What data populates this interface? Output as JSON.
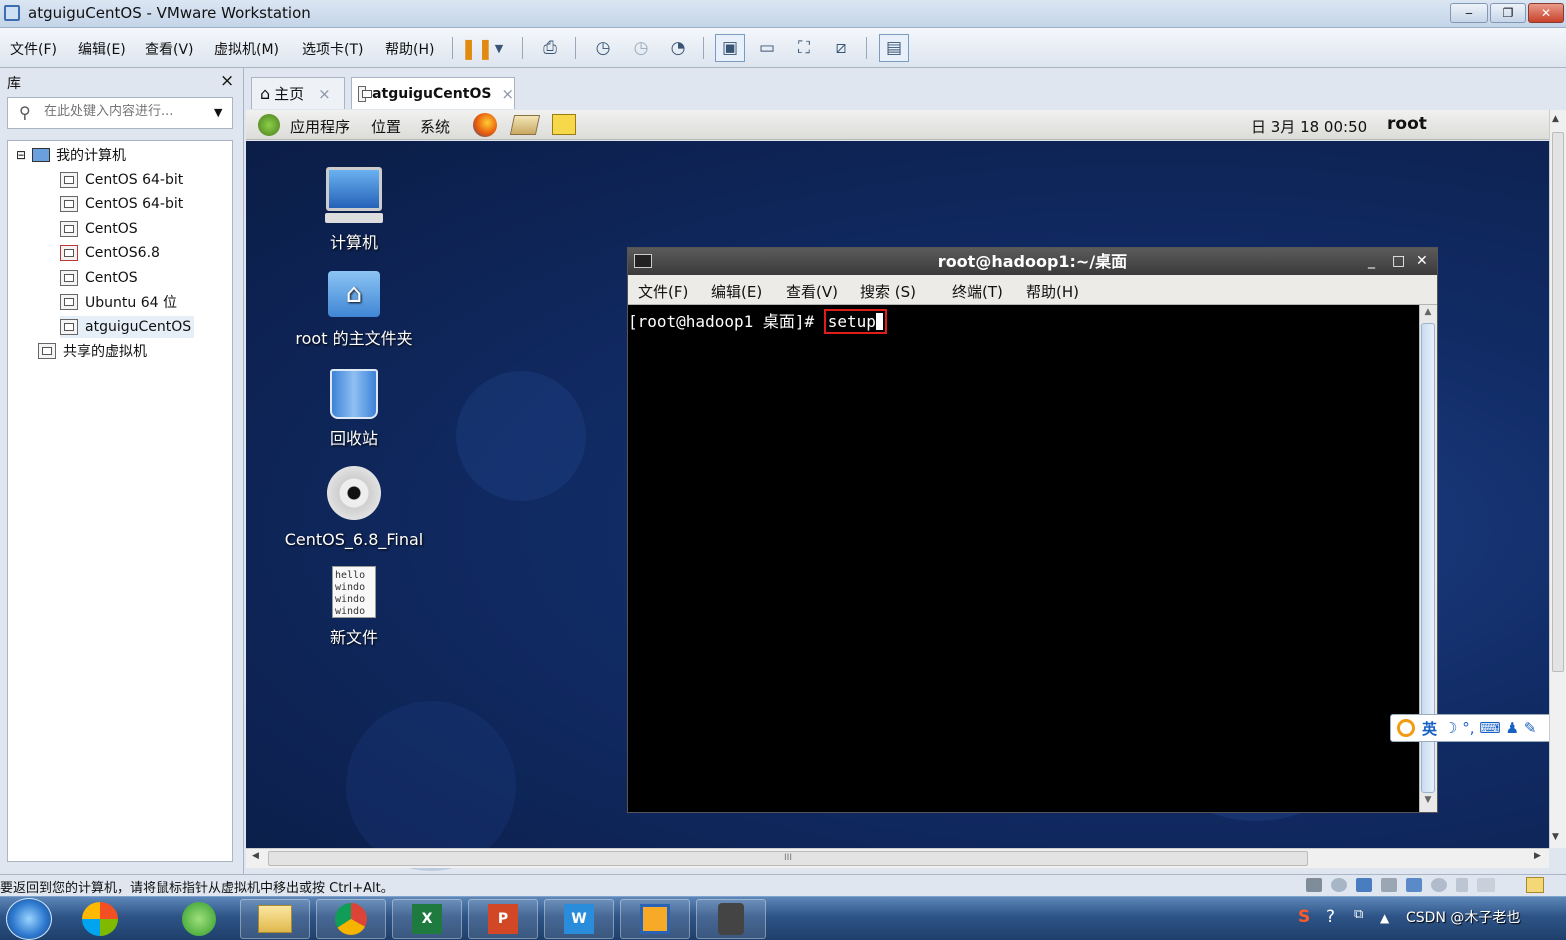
{
  "window": {
    "title": "atguiguCentOS - VMware Workstation",
    "controls": [
      "‒",
      "❐",
      "✕"
    ]
  },
  "menubar": [
    "文件(F)",
    "编辑(E)",
    "查看(V)",
    "虚拟机(M)",
    "选项卡(T)",
    "帮助(H)"
  ],
  "library": {
    "title": "库",
    "close": "×",
    "search_placeholder": "在此处键入内容进行...",
    "tree": {
      "root": "我的计算机",
      "toggle": "⊟",
      "vms": [
        "CentOS 64-bit",
        "CentOS 64-bit",
        "CentOS",
        "CentOS6.8",
        "CentOS",
        "Ubuntu 64 位",
        "atguiguCentOS"
      ],
      "shared": "共享的虚拟机"
    }
  },
  "tabs": [
    {
      "label": "主页",
      "close": "×"
    },
    {
      "label": "atguiguCentOS",
      "close": "×"
    }
  ],
  "gnome_panel": {
    "menus": [
      "应用程序",
      "位置",
      "系统"
    ],
    "clock": "日 3月 18 00:50",
    "user": "root"
  },
  "desktop_icons": [
    "计算机",
    "root 的主文件夹",
    "回收站",
    "CentOS_6.8_Final",
    "新文件"
  ],
  "new_file_preview": [
    "hello",
    "windo",
    "windo",
    "windo"
  ],
  "terminal": {
    "title": "root@hadoop1:~/桌面",
    "menu": [
      "文件(F)",
      "编辑(E)",
      "查看(V)",
      "搜索 (S)",
      "终端(T)",
      "帮助(H)"
    ],
    "prompt": "[root@hadoop1 桌面]# ",
    "command": "setup",
    "controls": [
      "_",
      "□",
      "✕"
    ]
  },
  "ime_bar": {
    "lang": "英",
    "symbols": "☽ °, ⌨ ♟ ✎"
  },
  "scrollbar": {
    "grip": "III",
    "up": "▲",
    "down": "▼",
    "left": "◀",
    "right": "▶"
  },
  "status": {
    "text": "要返回到您的计算机，请将鼠标指针从虚拟机中移出或按 Ctrl+Alt。"
  },
  "taskbar": {
    "tray_text": "CSDN @木子老也"
  }
}
